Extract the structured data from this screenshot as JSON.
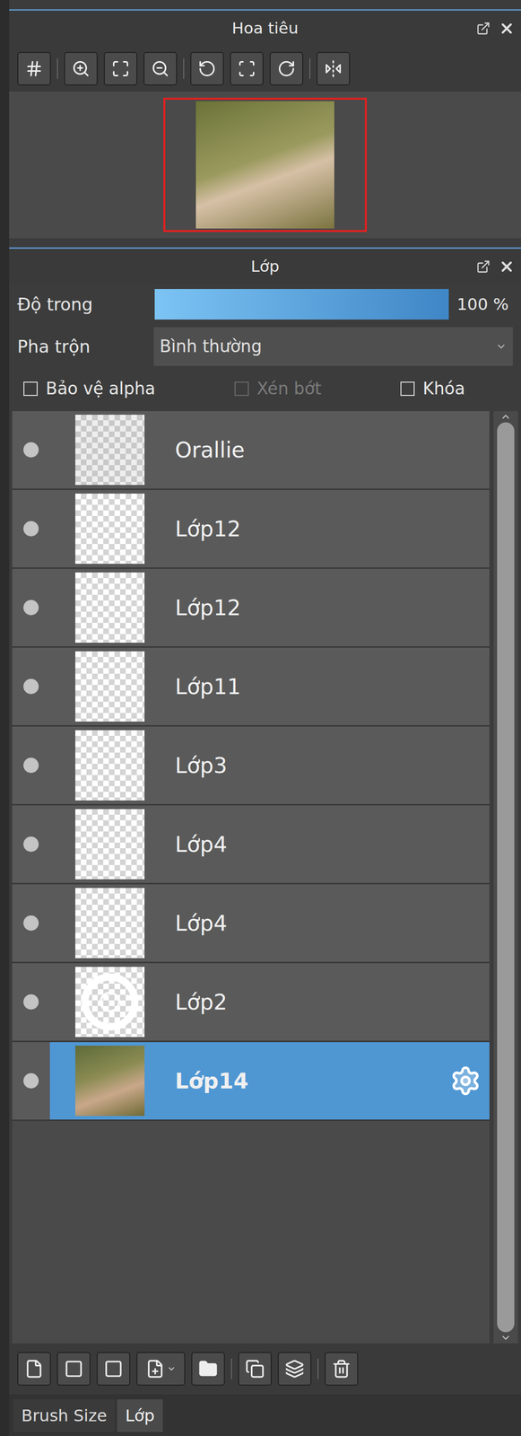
{
  "navigator": {
    "title": "Hoa tiêu"
  },
  "layers_panel": {
    "title": "Lớp",
    "opacity": {
      "label": "Độ trong",
      "value": "100 %",
      "level": 1
    },
    "blend": {
      "label": "Pha trộn",
      "value": "Bình thường"
    },
    "options": [
      {
        "label": "Bảo vệ alpha",
        "checked": false,
        "disabled": false
      },
      {
        "label": "Xén bớt",
        "checked": false,
        "disabled": true
      },
      {
        "label": "Khóa",
        "checked": false,
        "disabled": false
      }
    ],
    "layers": [
      {
        "name": "Orallie",
        "visible": true,
        "selected": false,
        "kind": "texture"
      },
      {
        "name": "Lớp12",
        "visible": true,
        "selected": false,
        "kind": "empty"
      },
      {
        "name": "Lớp12",
        "visible": true,
        "selected": false,
        "kind": "empty"
      },
      {
        "name": "Lớp11",
        "visible": true,
        "selected": false,
        "kind": "empty"
      },
      {
        "name": "Lớp3",
        "visible": true,
        "selected": false,
        "kind": "empty"
      },
      {
        "name": "Lớp4",
        "visible": true,
        "selected": false,
        "kind": "empty"
      },
      {
        "name": "Lớp4",
        "visible": true,
        "selected": false,
        "kind": "empty"
      },
      {
        "name": "Lớp2",
        "visible": true,
        "selected": false,
        "kind": "circle"
      },
      {
        "name": "Lớp14",
        "visible": true,
        "selected": true,
        "kind": "photo"
      }
    ]
  },
  "bottom_tabs": [
    {
      "label": "Brush Size",
      "selected": false
    },
    {
      "label": "Lớp",
      "selected": true
    }
  ]
}
